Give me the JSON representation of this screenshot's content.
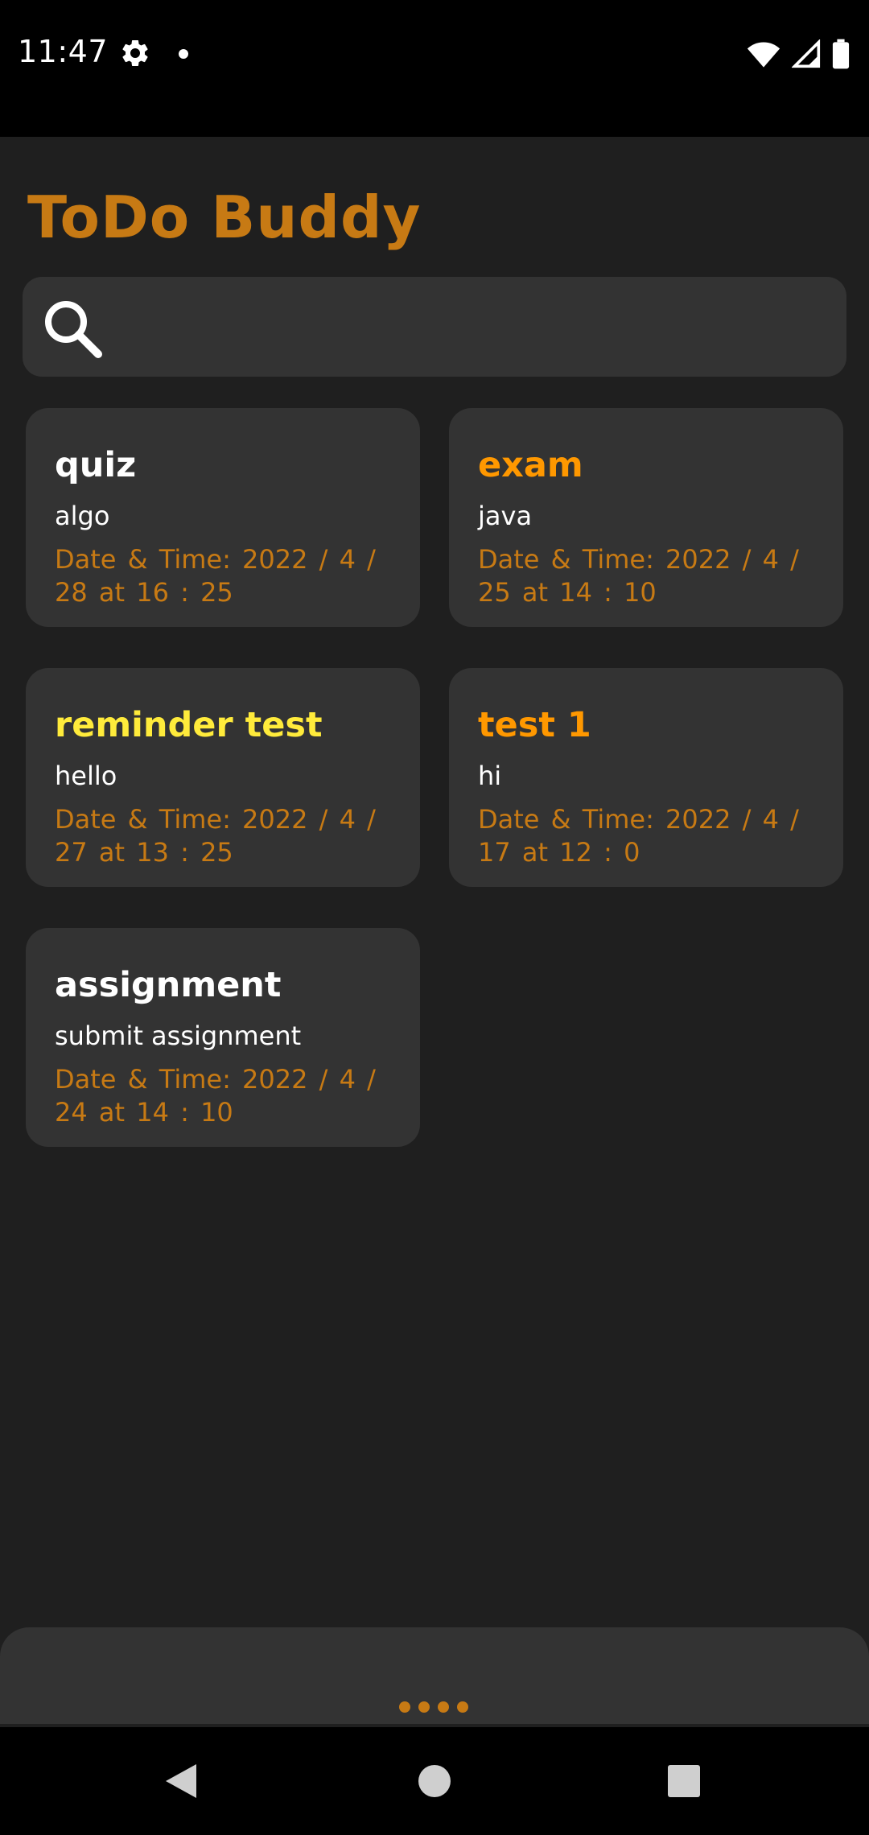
{
  "status_bar": {
    "time": "11:47",
    "icons": [
      "settings-icon",
      "notification-dot-icon",
      "wifi-icon",
      "cell-signal-icon",
      "battery-icon"
    ]
  },
  "app": {
    "title": "ToDo Buddy",
    "accent_color": "#c77a14"
  },
  "search": {
    "placeholder": "",
    "value": "",
    "icon": "search-icon"
  },
  "notes": [
    {
      "title": "quiz",
      "title_color": "#ffffff",
      "text": "algo",
      "date": "Date & Time:  2022 / 4 / 28  at  16 : 25"
    },
    {
      "title": "exam",
      "title_color": "#ff9800",
      "text": "java",
      "date": "Date & Time:  2022 / 4 / 25  at  14 : 10"
    },
    {
      "title": "reminder test",
      "title_color": "#ffeb3b",
      "text": "hello",
      "date": "Date & Time:  2022 / 4 / 27  at  13 : 25"
    },
    {
      "title": "test 1",
      "title_color": "#ff9800",
      "text": "hi",
      "date": "Date & Time:  2022 / 4 / 17  at  12 : 0"
    },
    {
      "title": "assignment",
      "title_color": "#ffffff",
      "text": "submit assignment",
      "date": "Date & Time:  2022 / 4 / 24  at  14 : 10"
    }
  ],
  "bottom_sheet": {
    "handle_icon": "drag-handle-dots-icon"
  },
  "nav_bar": {
    "buttons": [
      "back-icon",
      "home-icon",
      "recents-icon"
    ]
  }
}
